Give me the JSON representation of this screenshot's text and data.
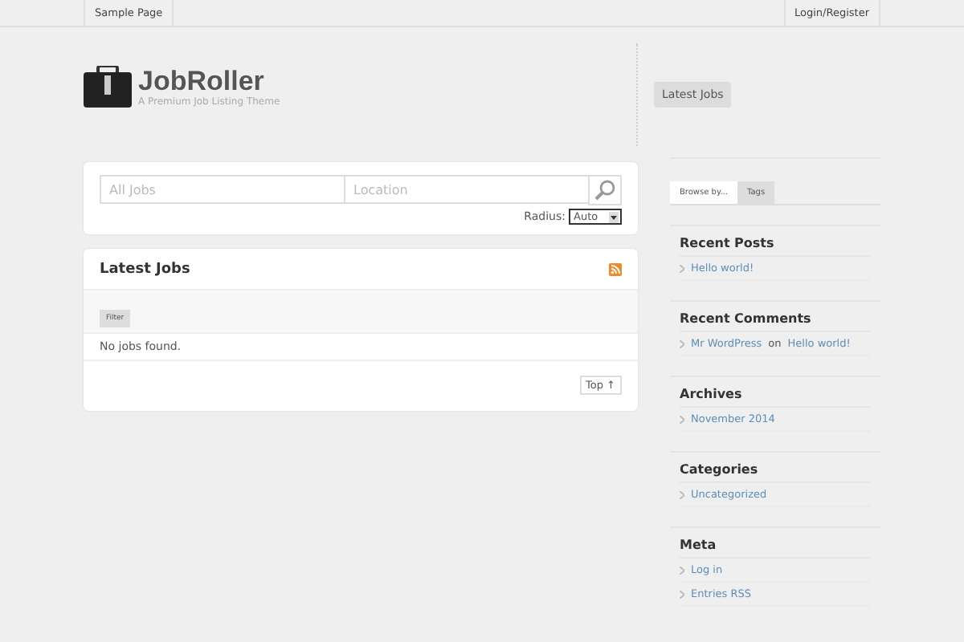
{
  "top_nav": {
    "left": [
      "Sample Page"
    ],
    "right": [
      "Login/Register"
    ]
  },
  "logo": {
    "title": "JobRoller",
    "tagline": "A Premium Job Listing Theme"
  },
  "header_tabs": [
    {
      "label": "Latest Jobs",
      "selected": true
    }
  ],
  "search": {
    "keywords_placeholder": "All Jobs",
    "location_placeholder": "Location",
    "radius_label": "Radius:",
    "radius_value": "Auto"
  },
  "jobs_panel": {
    "title": "Latest Jobs",
    "filter_button": "Filter",
    "message": "No jobs found.",
    "top_button": "Top ↑"
  },
  "sidebar_tabs": [
    {
      "label": "Browse by...",
      "selected": true
    },
    {
      "label": "Tags",
      "selected": false
    }
  ],
  "widgets": [
    {
      "title": "Recent Posts",
      "items": [
        {
          "kind": "link",
          "text": "Hello world!"
        }
      ]
    },
    {
      "title": "Recent Comments",
      "items": [
        {
          "kind": "comment",
          "author": "Mr WordPress",
          "joiner": "on",
          "post": "Hello world!"
        }
      ]
    },
    {
      "title": "Archives",
      "items": [
        {
          "kind": "link",
          "text": "November 2014"
        }
      ]
    },
    {
      "title": "Categories",
      "items": [
        {
          "kind": "link",
          "text": "Uncategorized"
        }
      ]
    },
    {
      "title": "Meta",
      "items": [
        {
          "kind": "link",
          "text": "Log in"
        },
        {
          "kind": "link",
          "text": "Entries RSS"
        }
      ]
    }
  ]
}
